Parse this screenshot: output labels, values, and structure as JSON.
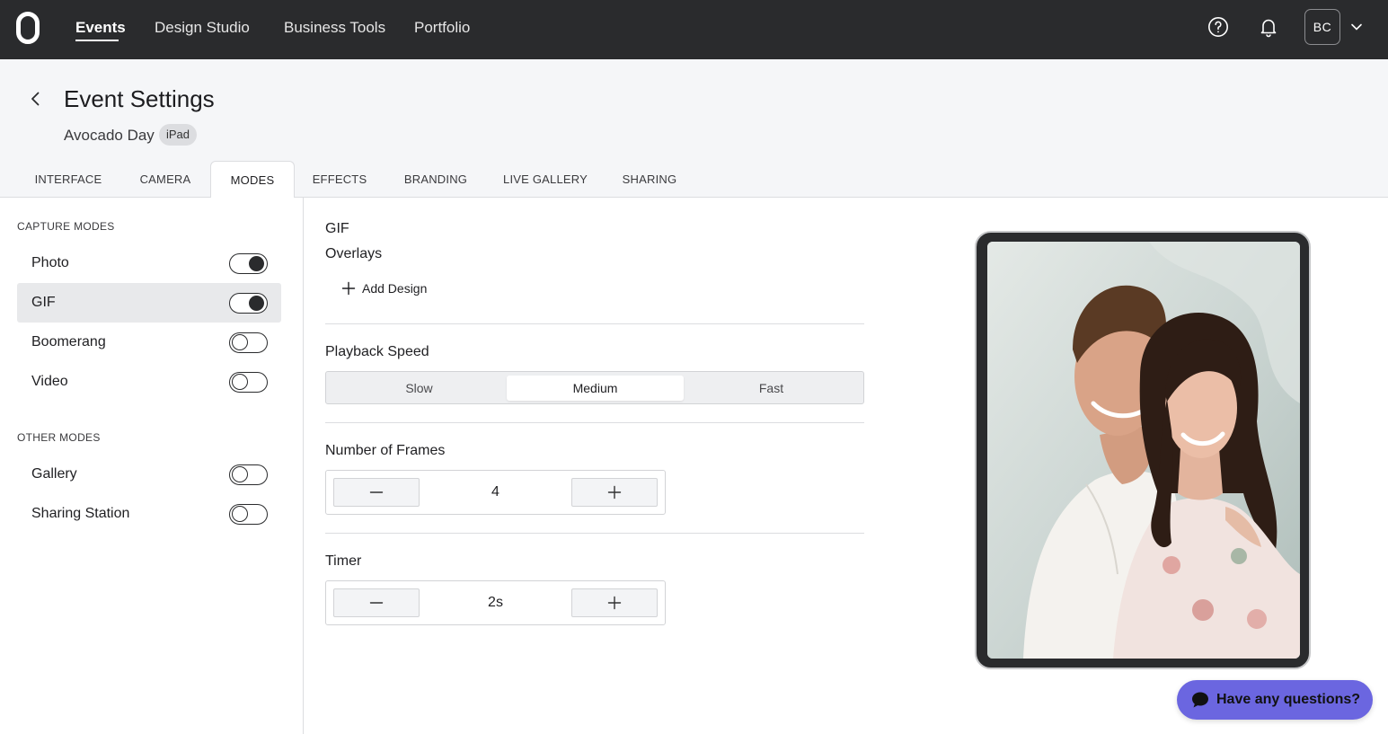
{
  "nav": {
    "items": [
      {
        "label": "Events",
        "active": true
      },
      {
        "label": "Design Studio",
        "active": false
      },
      {
        "label": "Business Tools",
        "active": false
      },
      {
        "label": "Portfolio",
        "active": false
      }
    ],
    "avatar_initials": "BC"
  },
  "header": {
    "title": "Event Settings",
    "event_name": "Avocado Day",
    "device_badge": "iPad"
  },
  "tabs": [
    {
      "label": "INTERFACE",
      "active": false
    },
    {
      "label": "CAMERA",
      "active": false
    },
    {
      "label": "MODES",
      "active": true
    },
    {
      "label": "EFFECTS",
      "active": false
    },
    {
      "label": "BRANDING",
      "active": false
    },
    {
      "label": "LIVE GALLERY",
      "active": false
    },
    {
      "label": "SHARING",
      "active": false
    }
  ],
  "sidebar": {
    "capture_label": "CAPTURE MODES",
    "capture_modes": [
      {
        "label": "Photo",
        "enabled": true,
        "selected": false
      },
      {
        "label": "GIF",
        "enabled": true,
        "selected": true
      },
      {
        "label": "Boomerang",
        "enabled": false,
        "selected": false
      },
      {
        "label": "Video",
        "enabled": false,
        "selected": false
      }
    ],
    "other_label": "OTHER MODES",
    "other_modes": [
      {
        "label": "Gallery",
        "enabled": false
      },
      {
        "label": "Sharing Station",
        "enabled": false
      }
    ]
  },
  "settings": {
    "mode_title": "GIF",
    "overlays_label": "Overlays",
    "add_design_label": "Add Design",
    "playback_label": "Playback Speed",
    "playback_options": [
      "Slow",
      "Medium",
      "Fast"
    ],
    "playback_selected": "Medium",
    "frames_label": "Number of Frames",
    "frames_value": "4",
    "timer_label": "Timer",
    "timer_value": "2s"
  },
  "chat": {
    "label": "Have any questions?"
  },
  "colors": {
    "nav_bg": "#2a2b2d",
    "header_bg": "#f5f6f8",
    "chat_accent": "#6b66e0"
  }
}
